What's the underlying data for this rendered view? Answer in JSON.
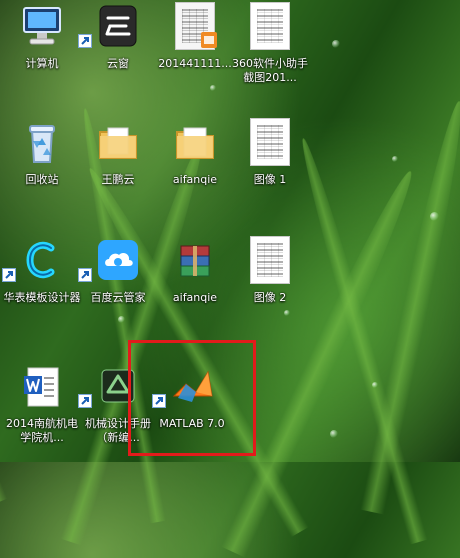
{
  "desktop": {
    "icons": [
      {
        "label": "计算机",
        "icon": "computer-icon",
        "shortcut": false
      },
      {
        "label": "云窗",
        "icon": "yunchuang-app-icon",
        "shortcut": true
      },
      {
        "label": "201441111...",
        "icon": "pdf-document-icon",
        "shortcut": false
      },
      {
        "label": "360软件小助手截图201...",
        "icon": "screenshot-image-icon",
        "shortcut": false
      },
      {
        "label": "回收站",
        "icon": "recycle-bin-icon",
        "shortcut": false
      },
      {
        "label": "王鹏云",
        "icon": "folder-icon",
        "shortcut": false
      },
      {
        "label": "aifanqie",
        "icon": "folder-icon",
        "shortcut": false
      },
      {
        "label": "图像 1",
        "icon": "image-file-icon",
        "shortcut": false
      },
      {
        "label": "华表模板设计器",
        "icon": "huabiao-template-designer-icon",
        "shortcut": true
      },
      {
        "label": "百度云管家",
        "icon": "baidu-cloud-icon",
        "shortcut": true
      },
      {
        "label": "aifanqie",
        "icon": "archive-rar-icon",
        "shortcut": false
      },
      {
        "label": "图像 2",
        "icon": "image-file-icon",
        "shortcut": false
      },
      {
        "label": "2014南航机电学院机...",
        "icon": "word-document-icon",
        "shortcut": false
      },
      {
        "label": "机械设计手册（新编...",
        "icon": "mechanical-handbook-icon",
        "shortcut": true
      },
      {
        "label": "MATLAB 7.0",
        "icon": "matlab-icon",
        "shortcut": true
      }
    ]
  }
}
